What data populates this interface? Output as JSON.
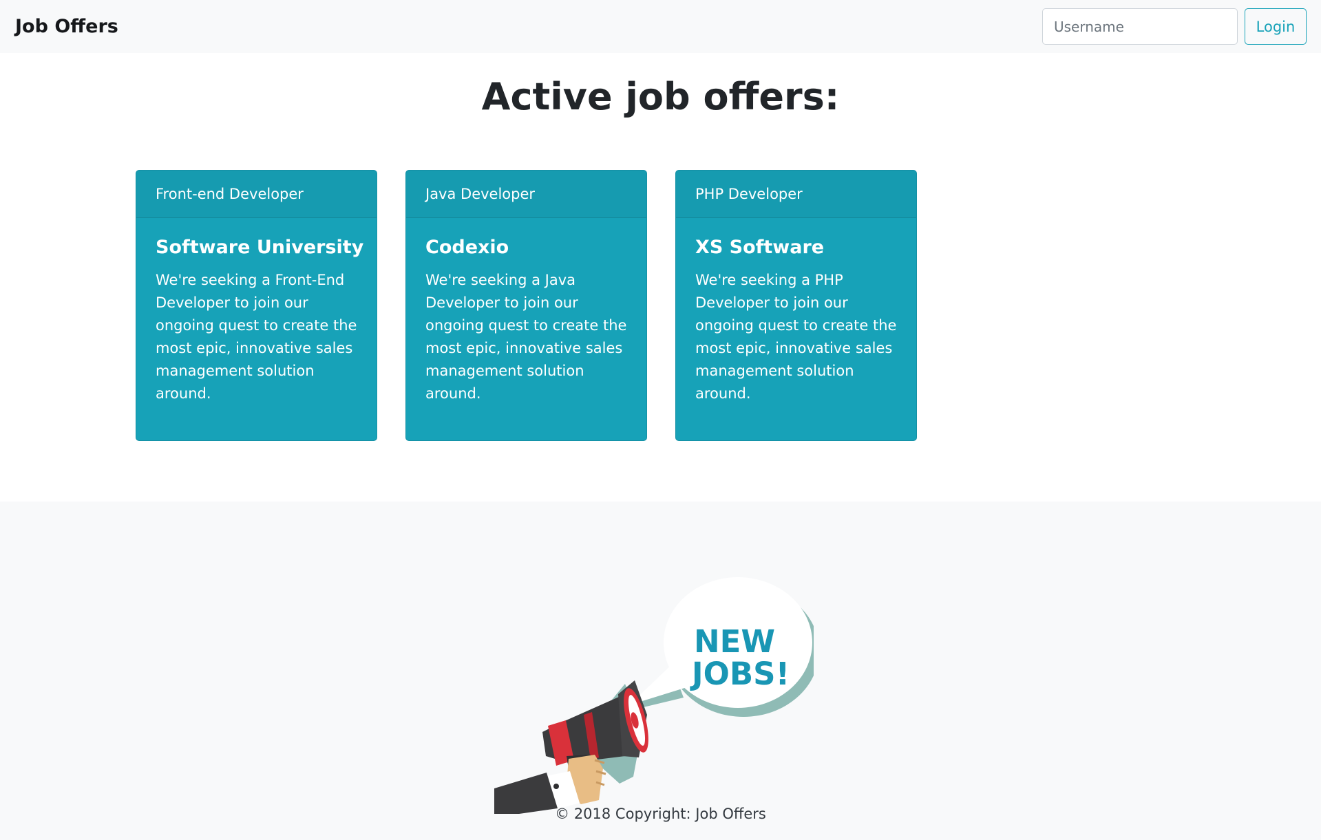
{
  "navbar": {
    "brand": "Job Offers",
    "username_placeholder": "Username",
    "login_label": "Login"
  },
  "main": {
    "title": "Active job offers:",
    "offers": [
      {
        "position": "Front-end Developer",
        "company": "Software University",
        "description": "We're seeking a Front-End Developer to join our ongoing quest to create the most epic, innovative sales management solution around."
      },
      {
        "position": "Java Developer",
        "company": "Codexio",
        "description": "We're seeking a Java Developer to join our ongoing quest to create the most epic, innovative sales management solution around."
      },
      {
        "position": "PHP Developer",
        "company": "XS Software",
        "description": "We're seeking a PHP Developer to join our ongoing quest to create the most epic, innovative sales management solution around."
      }
    ]
  },
  "footer": {
    "banner_line1": "NEW",
    "banner_line2": "JOBS!",
    "copyright": "© 2018 Copyright: Job Offers"
  },
  "colors": {
    "accent": "#17a2b8",
    "navbar_bg": "#f8f9fa",
    "text": "#212529"
  }
}
